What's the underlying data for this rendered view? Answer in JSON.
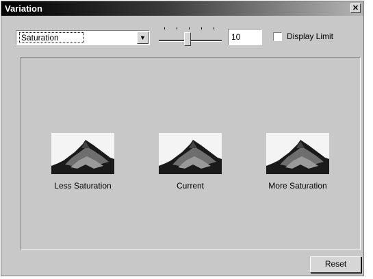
{
  "window": {
    "title": "Variation",
    "close_icon": "close-icon"
  },
  "toolbar": {
    "mode_select": {
      "value": "Saturation"
    },
    "amount_value": "10",
    "slider_level": 0.45,
    "display_limit": {
      "label": "Display Limit",
      "checked": false
    }
  },
  "variations": [
    {
      "label": "Less Saturation",
      "image": "pagoda-photo"
    },
    {
      "label": "Current",
      "image": "pagoda-photo"
    },
    {
      "label": "More Saturation",
      "image": "pagoda-photo"
    }
  ],
  "footer": {
    "reset_label": "Reset"
  }
}
